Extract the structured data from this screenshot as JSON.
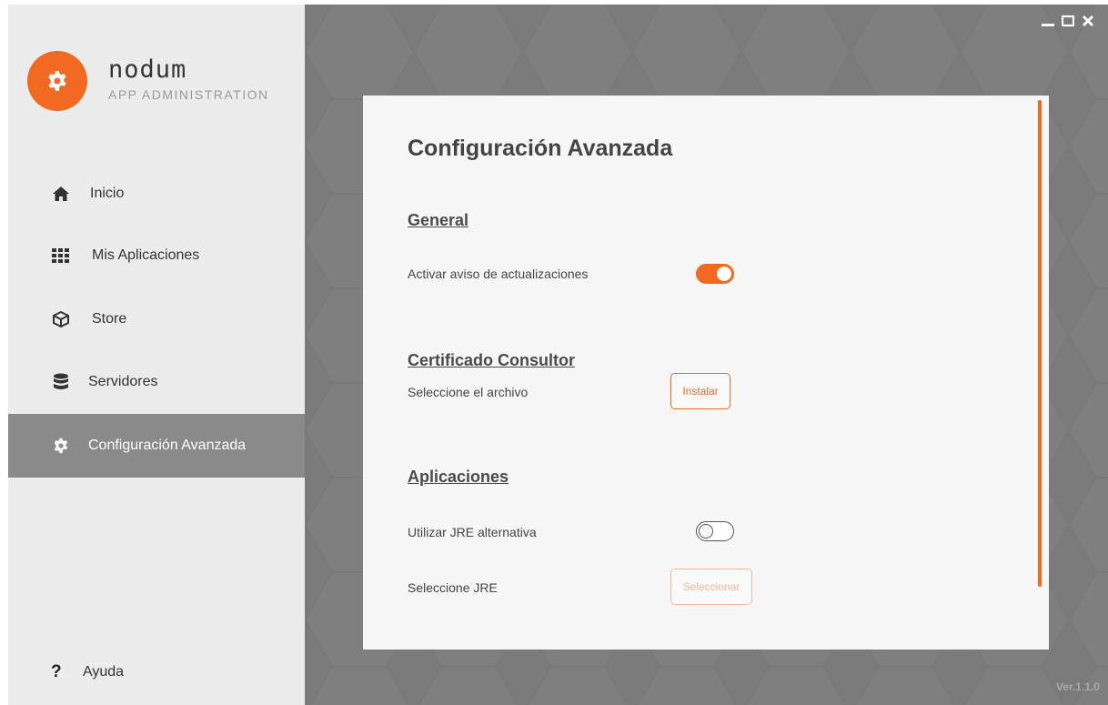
{
  "brand": {
    "name": "nodum",
    "subtitle": "APP ADMINISTRATION"
  },
  "sidebar": {
    "items": [
      {
        "label": "Inicio",
        "icon": "home-icon"
      },
      {
        "label": "Mis Aplicaciones",
        "icon": "grid-icon"
      },
      {
        "label": "Store",
        "icon": "box-icon"
      },
      {
        "label": "Servidores",
        "icon": "database-icon"
      },
      {
        "label": "Configuración Avanzada",
        "icon": "gear-icon",
        "active": true
      }
    ],
    "help_label": "Ayuda"
  },
  "window": {
    "version": "Ver.1.1.0"
  },
  "main": {
    "title": "Configuración Avanzada",
    "sections": {
      "general": {
        "title": "General",
        "update_notice_label": "Activar aviso de actualizaciones",
        "update_notice_enabled": true
      },
      "certificate": {
        "title": "Certificado Consultor",
        "select_file_label": "Seleccione el archivo",
        "install_button": "Instalar"
      },
      "apps": {
        "title": "Aplicaciones",
        "alt_jre_label": "Utilizar JRE alternativa",
        "alt_jre_enabled": false,
        "select_jre_label": "Seleccione JRE",
        "select_button": "Seleccionar"
      }
    }
  },
  "colors": {
    "accent": "#f26a21",
    "sidebar_bg": "#ececec",
    "active_item": "#8a8a8a",
    "window_bg": "#7d7d7d"
  }
}
